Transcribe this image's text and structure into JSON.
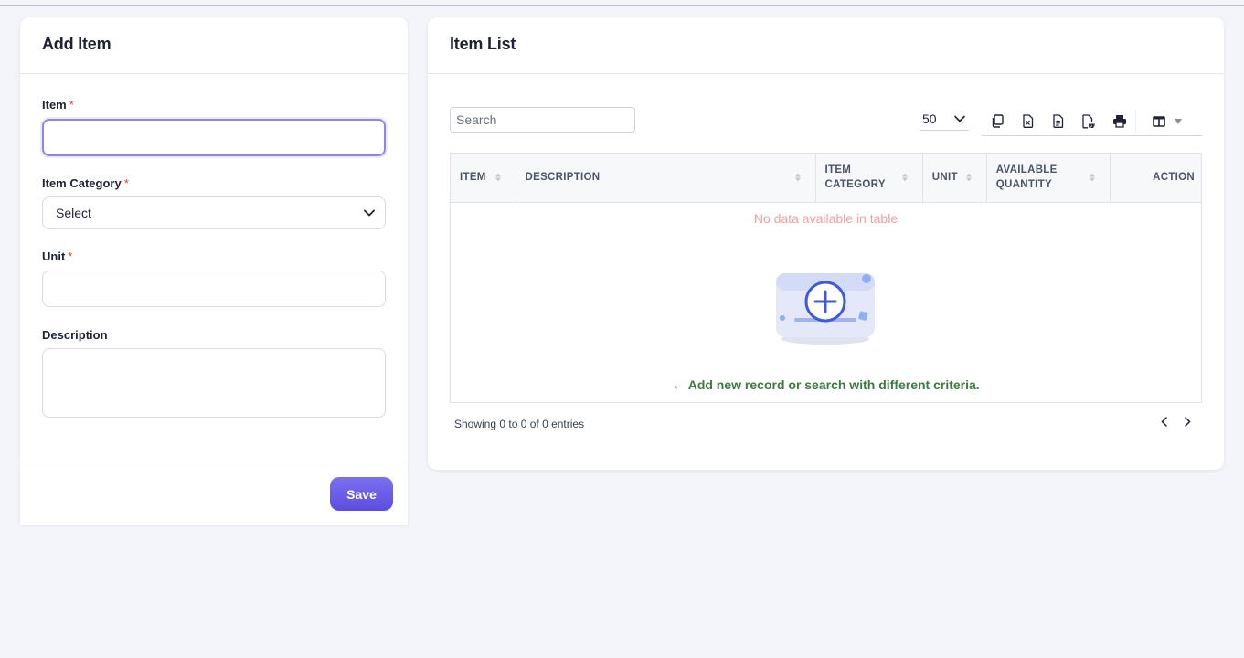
{
  "add_item": {
    "title": "Add Item",
    "fields": {
      "item": {
        "label": "Item",
        "required_mark": "*",
        "value": ""
      },
      "category": {
        "label": "Item Category",
        "required_mark": "*",
        "selected": "Select"
      },
      "unit": {
        "label": "Unit",
        "required_mark": "*",
        "value": ""
      },
      "description": {
        "label": "Description",
        "value": ""
      }
    },
    "save_label": "Save"
  },
  "item_list": {
    "title": "Item List",
    "search_placeholder": "Search",
    "page_length": "50",
    "export_icons": [
      "copy-icon",
      "excel-icon",
      "csv-icon",
      "pdf-icon",
      "print-icon"
    ],
    "columns_icon": "columns-icon",
    "columns": [
      "ITEM",
      "DESCRIPTION",
      "ITEM CATEGORY",
      "UNIT",
      "AVAILABLE QUANTITY",
      "ACTION"
    ],
    "empty_message": "No data available in table",
    "empty_hint": "Add new record or search with different criteria.",
    "info": "Showing 0 to 0 of 0 entries"
  },
  "colors": {
    "accent": "#6c5fe8",
    "required": "#e53e3e",
    "empty_message": "#f1a0a0",
    "hint": "#3f7a3f"
  }
}
